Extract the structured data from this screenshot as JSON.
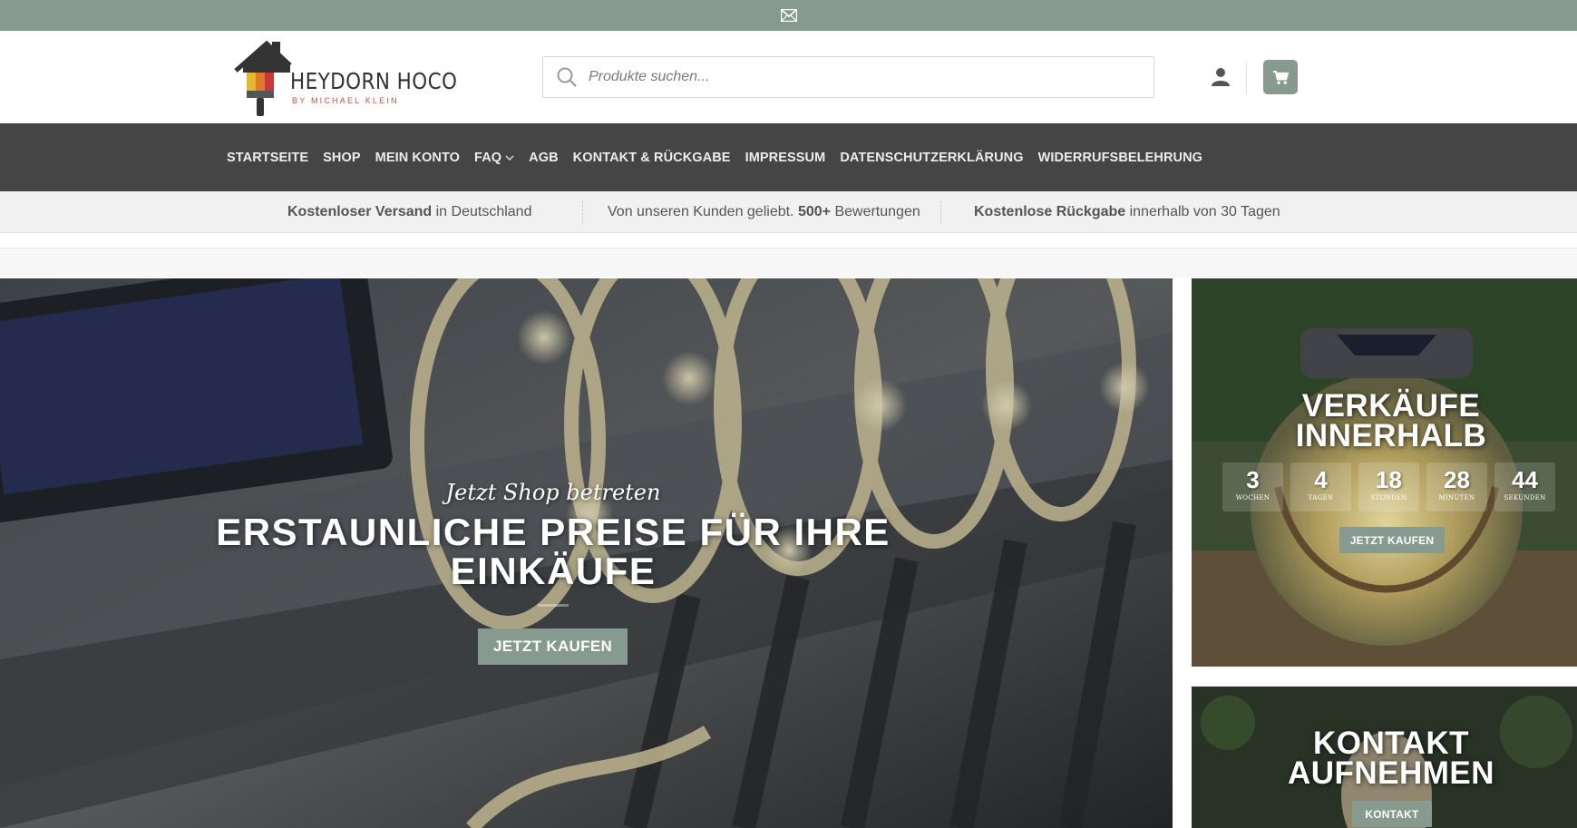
{
  "colors": {
    "accent": "#869a8f",
    "nav_bg": "#454545",
    "logo_red": "#c9504a"
  },
  "topbar": {
    "icon": "mail-icon"
  },
  "header": {
    "logo_name": "HEYDORN HOCO",
    "logo_sub": "BY MICHAEL KLEIN",
    "search": {
      "placeholder": "Produkte suchen...",
      "icon": "search-icon"
    },
    "account_icon": "user-icon",
    "cart_icon": "cart-icon"
  },
  "nav": {
    "items": [
      {
        "label": "STARTSEITE"
      },
      {
        "label": "SHOP"
      },
      {
        "label": "MEIN KONTO"
      },
      {
        "label": "FAQ",
        "has_dropdown": true
      },
      {
        "label": "AGB"
      },
      {
        "label": "KONTAKT & RÜCKGABE"
      },
      {
        "label": "IMPRESSUM"
      },
      {
        "label": "DATENSCHUTZERKLÄRUNG"
      },
      {
        "label": "WIDERRUFSBELEHRUNG"
      }
    ]
  },
  "benefits": [
    {
      "bold": "Kostenloser Versand",
      "text": " in Deutschland"
    },
    {
      "pre": "Von unseren Kunden geliebt. ",
      "bold": "500+",
      "text": " Bewertungen"
    },
    {
      "bold": "Kostenlose Rückgabe",
      "text": " innerhalb von 30 Tagen"
    }
  ],
  "hero": {
    "tagline": "Jetzt Shop betreten",
    "title": "ERSTAUNLICHE PREISE FÜR IHRE EINKÄUFE",
    "button": "JETZT KAUFEN"
  },
  "promo": {
    "title_line1": "VERKÄUFE",
    "title_line2": "INNERHALB",
    "countdown": [
      {
        "value": "3",
        "label": "WOCHEN"
      },
      {
        "value": "4",
        "label": "TAGEN"
      },
      {
        "value": "18",
        "label": "STUNDEN"
      },
      {
        "value": "28",
        "label": "MINUTEN"
      },
      {
        "value": "44",
        "label": "SEKUNDEN"
      }
    ],
    "button": "JETZT KAUFEN"
  },
  "contact": {
    "title_line1": "KONTAKT",
    "title_line2": "AUFNEHMEN",
    "button": "KONTAKT"
  }
}
